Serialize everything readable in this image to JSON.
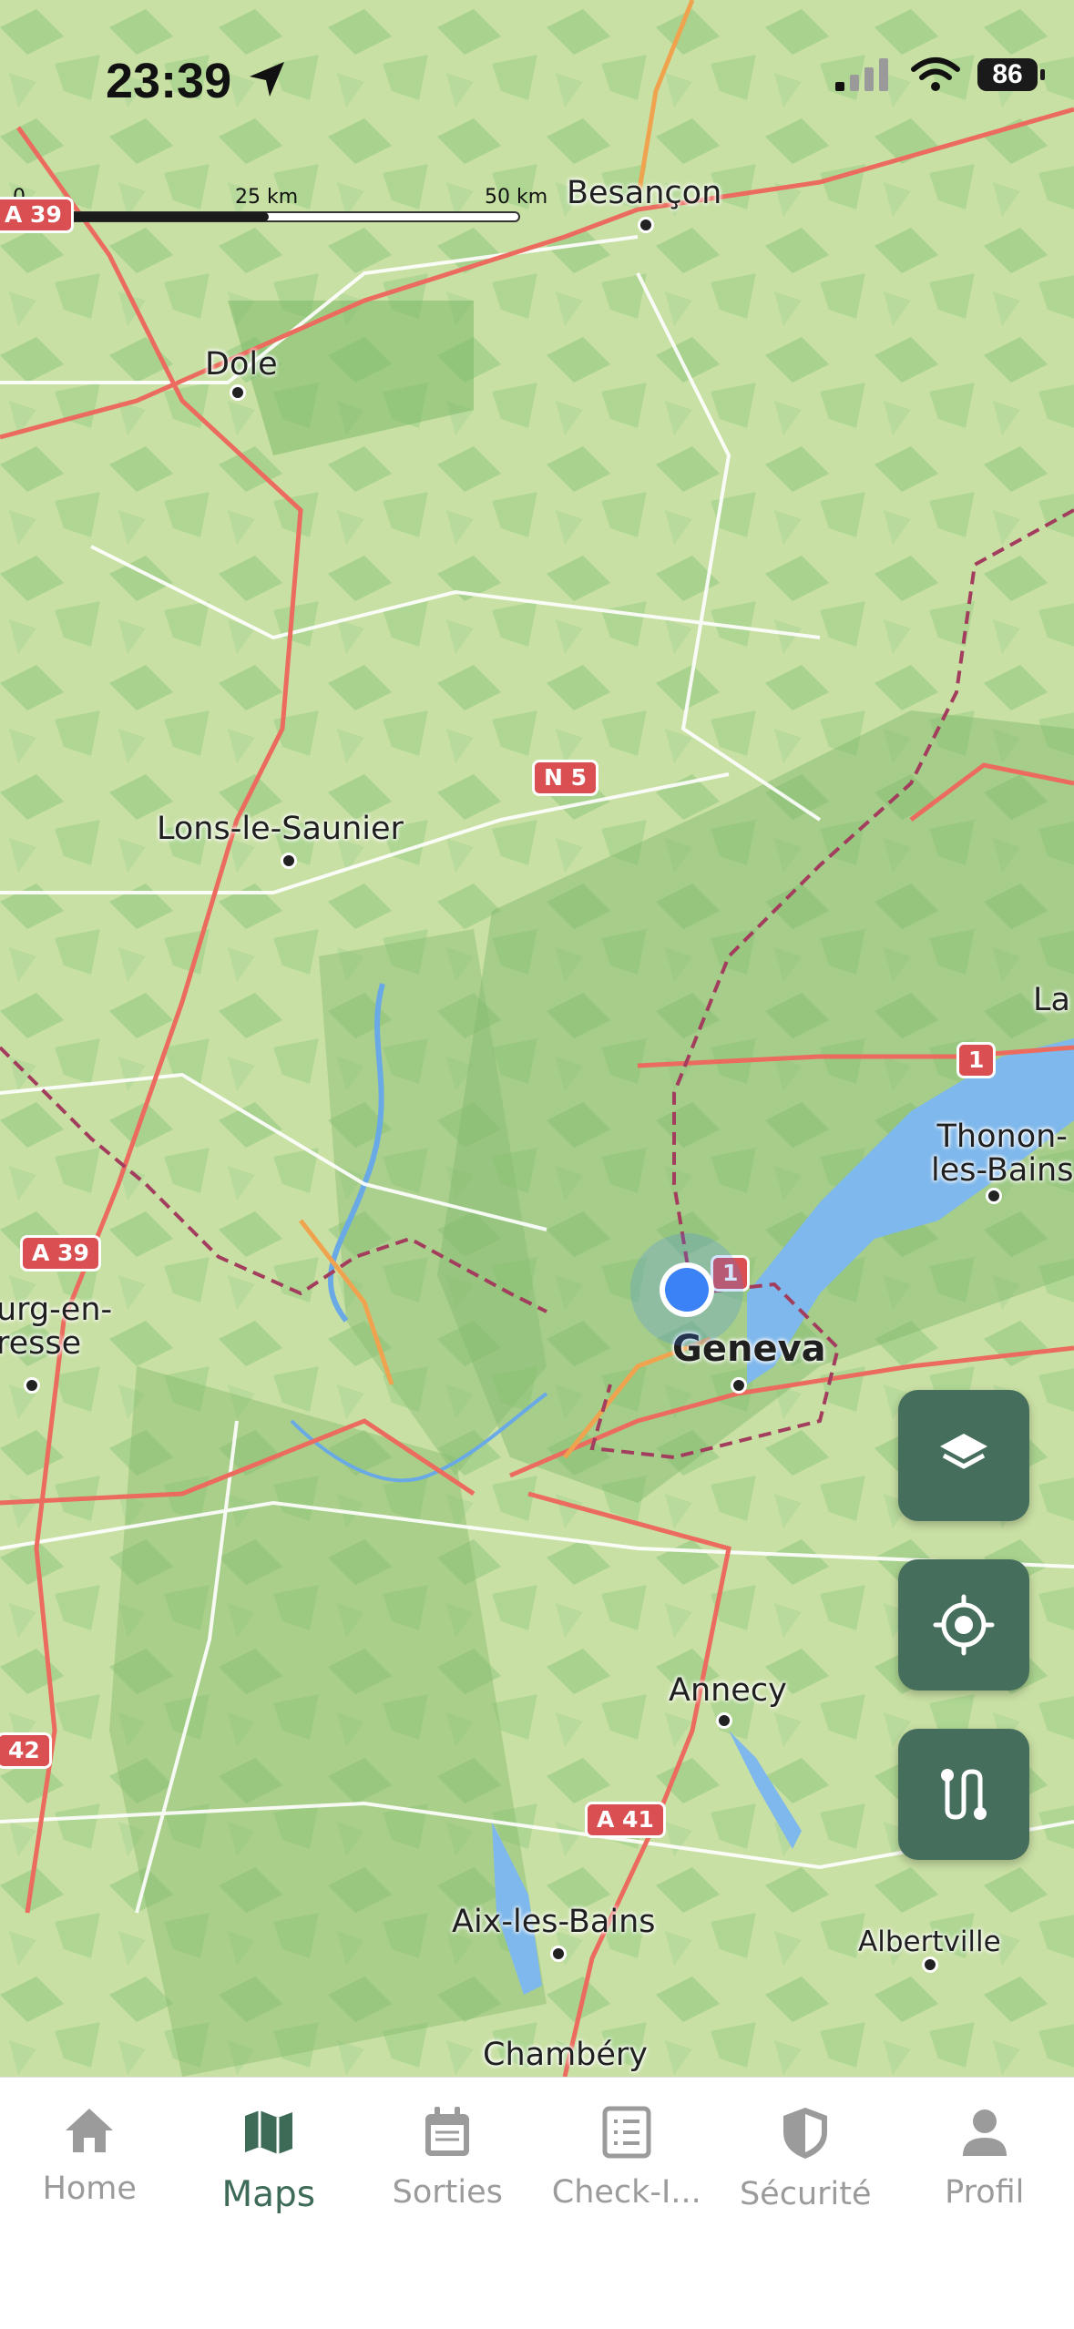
{
  "status_bar": {
    "time": "23:39",
    "battery": "86"
  },
  "scale": {
    "labels": [
      "0",
      "25 km",
      "50 km"
    ]
  },
  "map": {
    "cities": [
      {
        "name": "Besançon",
        "big": false
      },
      {
        "name": "Dole",
        "big": false
      },
      {
        "name": "Lons-le-Saunier",
        "big": false
      },
      {
        "name": "La",
        "big": false
      },
      {
        "name": "Thonon-\nles-Bains",
        "big": false
      },
      {
        "name": "urg-en-\nresse",
        "big": false
      },
      {
        "name": "Geneva",
        "big": true
      },
      {
        "name": "Annecy",
        "big": false
      },
      {
        "name": "Aix-les-Bains",
        "big": false
      },
      {
        "name": "Albertville",
        "big": false
      },
      {
        "name": "Chambéry",
        "big": false
      }
    ],
    "road_shields": [
      "A 39",
      "N 5",
      "1",
      "1",
      "A 39",
      "42",
      "A 41"
    ]
  },
  "fabs": {
    "layers_icon": "layers-icon",
    "locate_icon": "locate-icon",
    "route_icon": "route-icon"
  },
  "tabbar": {
    "items": [
      {
        "label": "Home",
        "icon": "home-icon"
      },
      {
        "label": "Maps",
        "icon": "map-icon"
      },
      {
        "label": "Sorties",
        "icon": "calendar-icon"
      },
      {
        "label": "Check-I...",
        "icon": "checklist-icon"
      },
      {
        "label": "Sécurité",
        "icon": "shield-icon"
      },
      {
        "label": "Profil",
        "icon": "person-icon"
      }
    ],
    "active_index": 1
  },
  "colors": {
    "accent": "#466e5d",
    "active_tab": "#3d6b57",
    "water": "#7fb8ec",
    "location": "#3b82f6"
  }
}
